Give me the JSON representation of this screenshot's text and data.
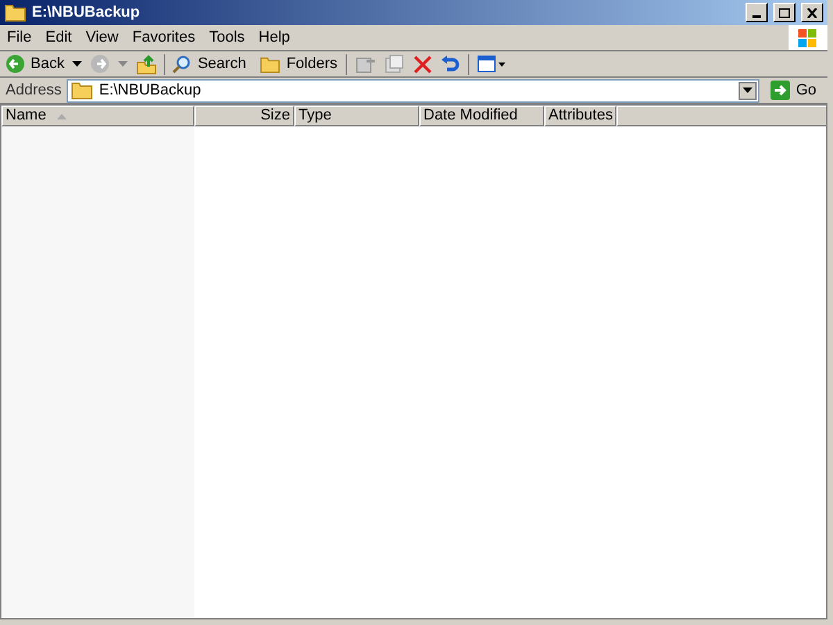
{
  "window": {
    "title": "E:\\NBUBackup"
  },
  "menu": [
    "File",
    "Edit",
    "View",
    "Favorites",
    "Tools",
    "Help"
  ],
  "toolbar": {
    "back": "Back",
    "search": "Search",
    "folders": "Folders"
  },
  "address": {
    "label": "Address",
    "value": "E:\\NBUBackup",
    "go": "Go"
  },
  "table": {
    "columns": [
      {
        "label": "Name",
        "sorted": true
      },
      {
        "label": "Size",
        "sorted": false
      },
      {
        "label": "Type",
        "sorted": false
      },
      {
        "label": "Date Modified",
        "sorted": false
      },
      {
        "label": "Attributes",
        "sorted": false
      }
    ]
  }
}
